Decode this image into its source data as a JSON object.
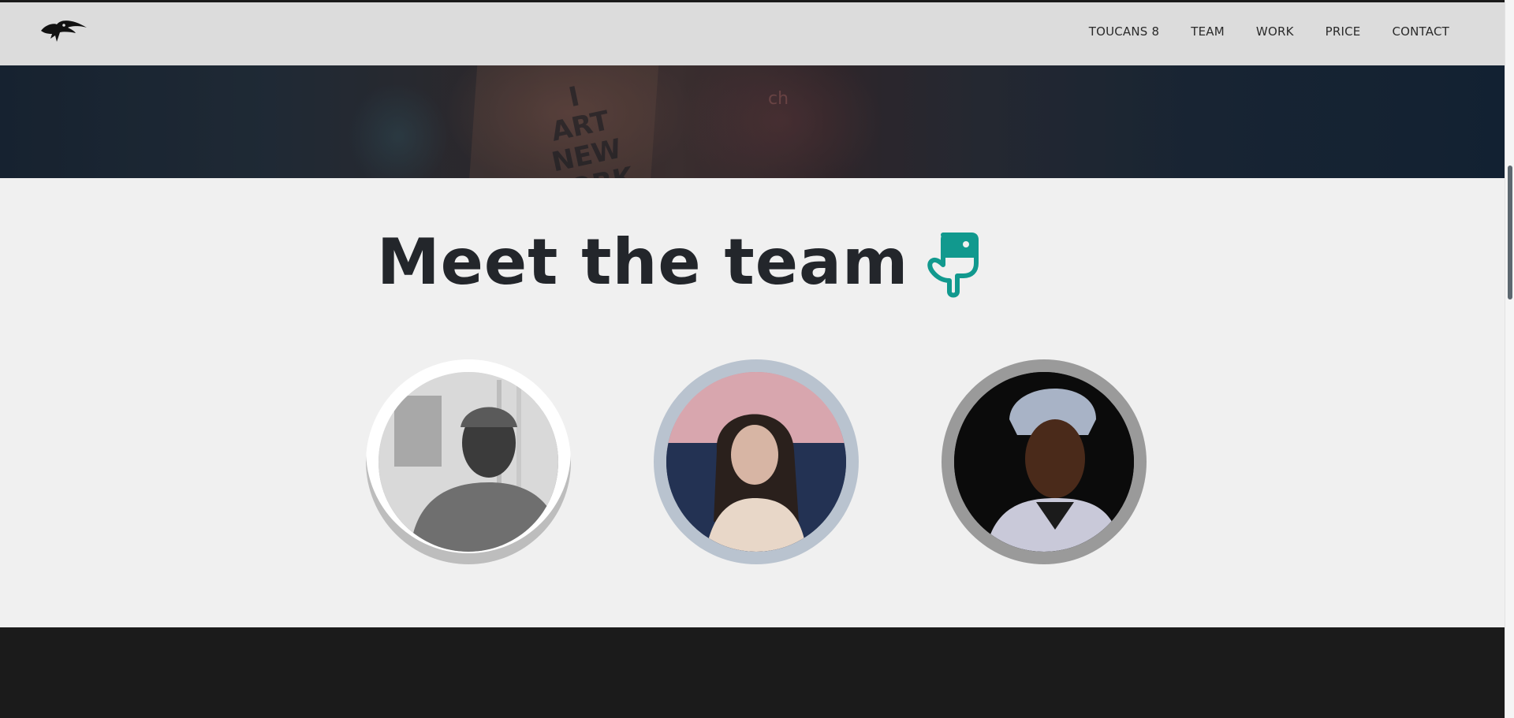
{
  "nav": {
    "logo_icon": "toucan-logo-icon",
    "links": [
      "TOUCANS 8",
      "TEAM",
      "WORK",
      "PRICE",
      "CONTACT"
    ]
  },
  "hero": {
    "board_lines": [
      "I",
      "ART",
      "NEW YORK"
    ],
    "sign_text": "ch"
  },
  "team": {
    "title": "Meet the team",
    "title_icon": "pointing-down-hand-icon",
    "accent_color": "#11998e",
    "members": [
      {
        "photo": "member-photo-1",
        "ring_color": "#ffffff"
      },
      {
        "photo": "member-photo-2",
        "ring_color": "#b9c3cf"
      },
      {
        "photo": "member-photo-3",
        "ring_color": "#9a9a9a"
      }
    ]
  },
  "colors": {
    "navbar_bg": "#dcdcdc",
    "page_bg": "#f0f0f0",
    "heading_text": "#23262b",
    "footer_bg": "#1b1b1b"
  }
}
